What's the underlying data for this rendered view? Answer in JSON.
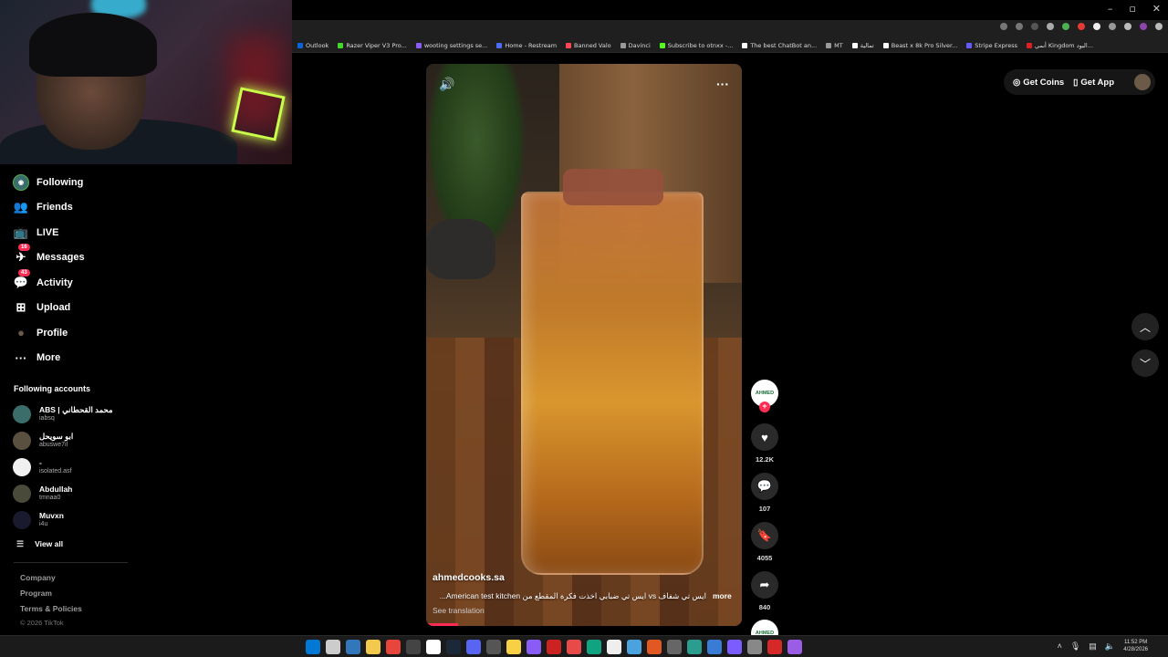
{
  "browser": {
    "window_controls": [
      "–",
      "▫",
      "✕"
    ],
    "bookmarks": [
      {
        "label": "Outlook",
        "color": "#0a64d8"
      },
      {
        "label": "Razer Viper V3 Pro...",
        "color": "#44d62c"
      },
      {
        "label": "wooting settings se...",
        "color": "#8a5cf6"
      },
      {
        "label": "Home - Restream",
        "color": "#4a6cf7"
      },
      {
        "label": "Banned Valo",
        "color": "#ff4655"
      },
      {
        "label": "Davinci",
        "color": "#999999"
      },
      {
        "label": "Subscribe to otnxx -...",
        "color": "#53fc18"
      },
      {
        "label": "The best ChatBot an...",
        "color": "#ffffff"
      },
      {
        "label": "MT",
        "color": "#999999"
      },
      {
        "label": "تمالية",
        "color": "#ffffff"
      },
      {
        "label": "Beast x 8k Pro Silver...",
        "color": "#ffffff"
      },
      {
        "label": "Stripe Express",
        "color": "#635bff"
      },
      {
        "label": "أنمي Kingdom البود...",
        "color": "#e02020"
      }
    ]
  },
  "sidebar": {
    "nav": [
      {
        "label": "Following",
        "icon": "following-avatar-icon"
      },
      {
        "label": "Friends",
        "icon": "friends-icon"
      },
      {
        "label": "LIVE",
        "icon": "live-icon"
      },
      {
        "label": "Messages",
        "icon": "messages-icon",
        "badge": "16"
      },
      {
        "label": "Activity",
        "icon": "activity-icon",
        "badge": "43"
      },
      {
        "label": "Upload",
        "icon": "upload-icon"
      },
      {
        "label": "Profile",
        "icon": "profile-icon"
      },
      {
        "label": "More",
        "icon": "more-icon"
      }
    ],
    "following_title": "Following accounts",
    "accounts": [
      {
        "name": "ABS | محمد القحطاني",
        "handle": "iabsq",
        "color": "#3b6e6a"
      },
      {
        "name": "ابو سويحل",
        "handle": "abuswe7il",
        "color": "#5a5040"
      },
      {
        "name": "-",
        "handle": "isolated.asf",
        "color": "#f0f0f0"
      },
      {
        "name": "Abdullah",
        "handle": "tmnaa0",
        "color": "#4a4a3a"
      },
      {
        "name": "Muvxn",
        "handle": "i4u",
        "color": "#1a1a2e"
      }
    ],
    "view_all": "View all",
    "footer": [
      "Company",
      "Program",
      "Terms & Policies"
    ],
    "copyright": "© 2026 TikTok"
  },
  "video": {
    "username": "ahmedcooks.sa",
    "caption": "ايس تي شفاف vs ايس تي ضبابي اخذت فكرة المقطع من American test kitchen...",
    "more_label": "more",
    "see_translation": "See translation",
    "progress": 0.1
  },
  "actions": {
    "creator_avatar_text": "AHMED",
    "likes": "12.2K",
    "comments": "107",
    "saves": "4055",
    "shares": "840"
  },
  "topbar": {
    "get_coins": "Get Coins",
    "get_app": "Get App"
  },
  "taskbar": {
    "icons": [
      "#0078d4",
      "#cccccc",
      "#3277bc",
      "#f2c94c",
      "#e8453c",
      "#444444",
      "#ffffff",
      "#1b2838",
      "#5865f2",
      "#555555",
      "#f7d046",
      "#8a5cf6",
      "#cc2222",
      "#e84a4a",
      "#10a37f",
      "#eeeeee",
      "#4aa3df",
      "#e25822",
      "#666666",
      "#2a9d8f",
      "#3a7bd5",
      "#7a5cff",
      "#888888",
      "#d62828",
      "#9b5de5"
    ],
    "time": "11:52 PM",
    "date": "4/28/2026"
  }
}
